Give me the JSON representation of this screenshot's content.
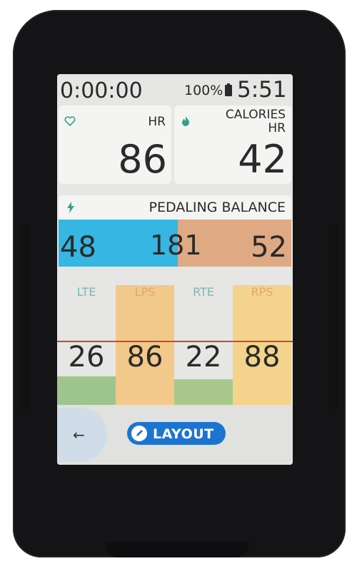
{
  "status": {
    "timer": "0:00:00",
    "battery_percent": "100%",
    "battery_icon": "battery-icon",
    "clock": "5:51"
  },
  "fields": {
    "hr": {
      "label": "HR",
      "value": "86",
      "icon": "heart-icon"
    },
    "calories": {
      "label_line1": "CALORIES",
      "label_line2": "HR",
      "value": "42",
      "icon": "flame-icon"
    }
  },
  "pedaling_balance": {
    "title": "PEDALING BALANCE",
    "icon": "bolt-icon",
    "left_value": "48",
    "center_value": "181",
    "right_value": "52",
    "left_fraction": 0.48
  },
  "grid": {
    "columns": [
      {
        "label": "LTE",
        "value": "26"
      },
      {
        "label": "LPS",
        "value": "86"
      },
      {
        "label": "RTE",
        "value": "22"
      },
      {
        "label": "RPS",
        "value": "88"
      }
    ]
  },
  "nav": {
    "back_icon": "arrow-left-icon",
    "back_glyph": "←",
    "layout_label": "LAYOUT",
    "layout_icon": "pencil-icon"
  },
  "colors": {
    "left_balance": "#35b6e3",
    "right_balance": "#dfa983",
    "lte_accent": "#7fb7b0",
    "lps_accent": "#f2c98a",
    "rte_accent": "#a9c98c",
    "rps_accent": "#f4d38c",
    "layout_button": "#1d74d0",
    "target_line": "#d4452b"
  }
}
